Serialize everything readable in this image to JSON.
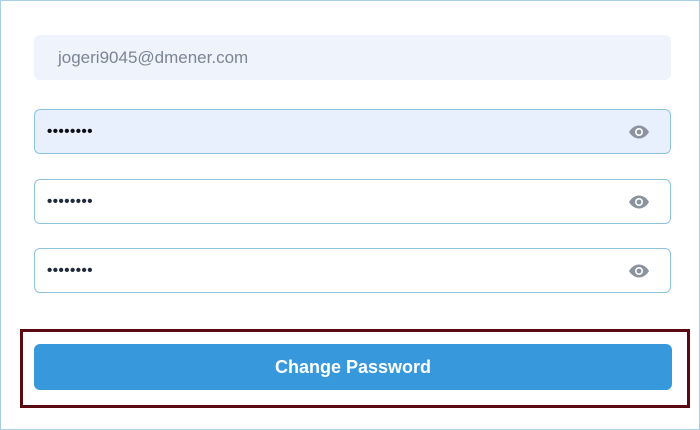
{
  "email": {
    "value": "jogeri9045@dmener.com"
  },
  "password_fields": [
    {
      "mask": "••••••••",
      "toggle_icon": "eye-icon",
      "focused": true
    },
    {
      "mask": "••••••••",
      "toggle_icon": "eye-icon",
      "focused": false
    },
    {
      "mask": "••••••••",
      "toggle_icon": "eye-icon",
      "focused": false
    }
  ],
  "submit": {
    "label": "Change Password"
  },
  "colors": {
    "primary": "#3799dc",
    "input_border": "#8ec3de",
    "readonly_bg": "#eef3fc",
    "focused_bg": "#e7f0fc",
    "highlight_border": "#5a0a10",
    "icon": "#8a939e"
  }
}
